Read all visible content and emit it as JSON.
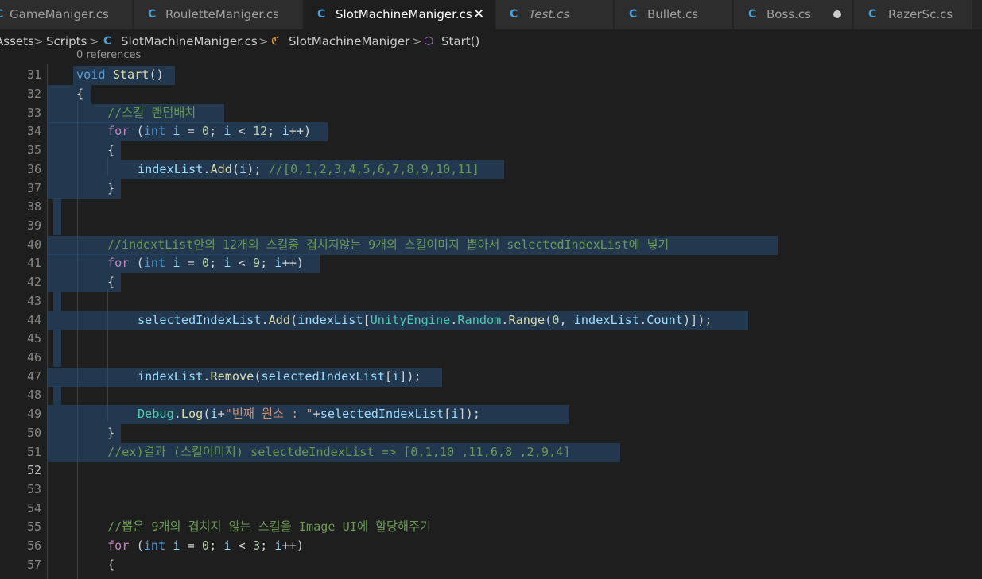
{
  "colors": {
    "cs_icon": "#4aa0d8",
    "class_icon": "#ee9d28",
    "method_icon": "#b180d7",
    "selection": "#264f78",
    "comment": "#6a9955",
    "keyword": "#569cd6",
    "control": "#c586c0",
    "function": "#dcdcaa",
    "variable": "#9cdcfe",
    "number": "#b5cea8",
    "string": "#ce9178",
    "type": "#4ec9b0"
  },
  "tabs": [
    {
      "icon": "csharp-file-icon",
      "label": "GameManiger.cs"
    },
    {
      "icon": "csharp-file-icon",
      "label": "RouletteManiger.cs"
    },
    {
      "icon": "csharp-file-icon",
      "label": "SlotMachineManiger.cs",
      "active": true,
      "close": "✕"
    },
    {
      "icon": "csharp-file-icon",
      "label": "Test.cs",
      "italic": true
    },
    {
      "icon": "csharp-file-icon",
      "label": "Bullet.cs"
    },
    {
      "icon": "csharp-file-icon",
      "label": "Boss.cs",
      "dirty": true
    },
    {
      "icon": "csharp-file-icon",
      "label": "RazerSc.cs"
    }
  ],
  "breadcrumb": {
    "folder1": "Assets",
    "folder2": "Scripts",
    "file": "SlotMachineManiger.cs",
    "class_name": "SlotMachineManiger",
    "method": "Start()"
  },
  "codelens": "0 references",
  "line_numbers": [
    "31",
    "32",
    "33",
    "34",
    "35",
    "36",
    "37",
    "38",
    "39",
    "40",
    "41",
    "42",
    "43",
    "44",
    "45",
    "46",
    "47",
    "48",
    "49",
    "50",
    "51",
    "52",
    "53",
    "54",
    "55",
    "56",
    "57"
  ],
  "current_line": "52",
  "code": {
    "l31": {
      "kw": "void",
      "fn": "Start",
      "p": "()"
    },
    "l32": {
      "p": "{"
    },
    "l33": {
      "cmt": "//스킬 랜덤배치"
    },
    "l34": {
      "ctl": "for",
      "p1": " (",
      "kw": "int",
      "v1": "i",
      "p2": " = ",
      "n1": "0",
      "p3": "; ",
      "v2": "i",
      "p4": " < ",
      "n2": "12",
      "p5": "; ",
      "v3": "i",
      "p6": "++)"
    },
    "l35": {
      "p": "{"
    },
    "l36": {
      "v1": "indexList",
      "p1": ".",
      "fn": "Add",
      "p2": "(",
      "v2": "i",
      "p3": "); ",
      "cmt": "//[0,1,2,3,4,5,6,7,8,9,10,11]"
    },
    "l37": {
      "p": "}"
    },
    "l40": {
      "cmt": "//indextList안의 12개의 스킬중 겹치지않는 9개의 스킬이미지 뽑아서 selectedIndexList에 넣기"
    },
    "l41": {
      "ctl": "for",
      "p1": " (",
      "kw": "int",
      "v1": "i",
      "p2": " = ",
      "n1": "0",
      "p3": "; ",
      "v2": "i",
      "p4": " < ",
      "n2": "9",
      "p5": "; ",
      "v3": "i",
      "p6": "++)"
    },
    "l42": {
      "p": "{"
    },
    "l44": {
      "v1": "selectedIndexList",
      "p1": ".",
      "fn1": "Add",
      "p2": "(",
      "v2": "indexList",
      "p3": "[",
      "c1": "UnityEngine",
      "p4": ".",
      "c2": "Random",
      "p5": ".",
      "fn2": "Range",
      "p6": "(",
      "n1": "0",
      "p7": ", ",
      "v3": "indexList",
      "p8": ".",
      "v4": "Count",
      "p9": ")]);"
    },
    "l47": {
      "v1": "indexList",
      "p1": ".",
      "fn": "Remove",
      "p2": "(",
      "v2": "selectedIndexList",
      "p3": "[",
      "v3": "i",
      "p4": "]);"
    },
    "l49": {
      "c1": "Debug",
      "p1": ".",
      "fn": "Log",
      "p2": "(",
      "v1": "i",
      "p3": "+",
      "s1": "\"번째 원소 : \"",
      "p4": "+",
      "v2": "selectedIndexList",
      "p5": "[",
      "v3": "i",
      "p6": "]);"
    },
    "l50": {
      "p": "}"
    },
    "l51": {
      "cmt": "//ex)결과 (스킬이미지) selectdeIndexList => [0,1,10 ,11,6,8 ,2,9,4]"
    },
    "l55": {
      "cmt": "//뽑은 9개의 겹치지 않는 스킬을 Image UI에 할당해주기"
    },
    "l56": {
      "ctl": "for",
      "p1": " (",
      "kw": "int",
      "v1": "i",
      "p2": " = ",
      "n1": "0",
      "p3": "; ",
      "v2": "i",
      "p4": " < ",
      "n2": "3",
      "p5": "; ",
      "v3": "i",
      "p6": "++)"
    },
    "l57": {
      "p": "{"
    }
  }
}
